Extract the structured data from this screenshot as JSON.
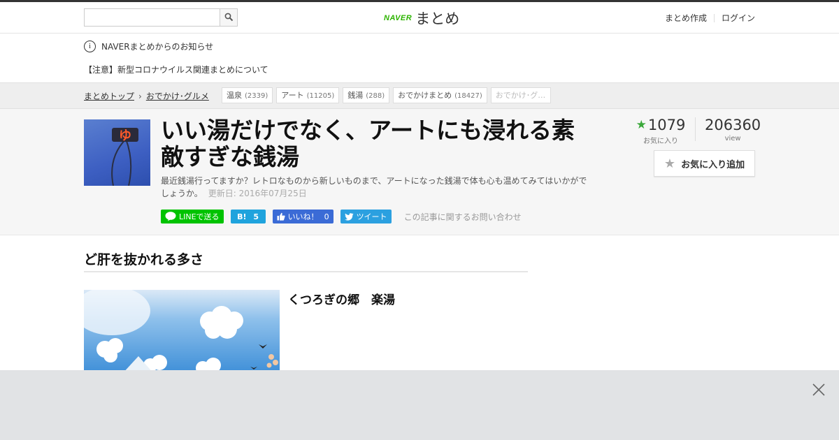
{
  "header": {
    "search_placeholder": "",
    "logo_brand": "NAVER",
    "logo_service": "まとめ",
    "links": [
      "まとめ作成",
      "ログイン"
    ]
  },
  "notice": {
    "title": "NAVERまとめからのお知らせ",
    "alert": "【注意】新型コロナウイルス関連まとめについて"
  },
  "breadcrumb": {
    "items": [
      "まとめトップ",
      "おでかけ･グルメ"
    ]
  },
  "tags": [
    {
      "label": "温泉",
      "count": "(2339)"
    },
    {
      "label": "アート",
      "count": "(11205)"
    },
    {
      "label": "銭湯",
      "count": "(288)"
    },
    {
      "label": "おでかけまとめ",
      "count": "(18427)"
    },
    {
      "label": "おでかけ･グ…",
      "count": ""
    }
  ],
  "article": {
    "title": "いい湯だけでなく、アートにも浸れる素敵すぎな銭湯",
    "description": "最近銭湯行ってますか？レトロなものから新しいものまで、アートになった銭湯で体も心も温めてみてはいかがでしょうか。",
    "updated": "更新日: 2016年07月25日",
    "thumb_sign": "ゆ",
    "social": {
      "line": "LINEで送る",
      "hatena_icon": "B!",
      "hatena_count": "5",
      "facebook": "いいね！",
      "facebook_count": "0",
      "twitter": "ツイート",
      "contact": "この記事に関するお問い合わせ"
    },
    "stats": {
      "favorites": "1079",
      "favorites_label": "お気に入り",
      "views": "206360",
      "views_label": "view"
    },
    "fav_button": "お気に入り追加"
  },
  "section": {
    "heading": "ど肝を抜かれる多さ",
    "item_title": "くつろぎの郷　楽湯"
  },
  "colors": {
    "brand_green": "#2db400",
    "line_green": "#00c300",
    "hatena_blue": "#1fa3dd",
    "facebook_blue": "#3b6bd6",
    "twitter_blue": "#2ba0e0",
    "star_green": "#3aa83a"
  }
}
